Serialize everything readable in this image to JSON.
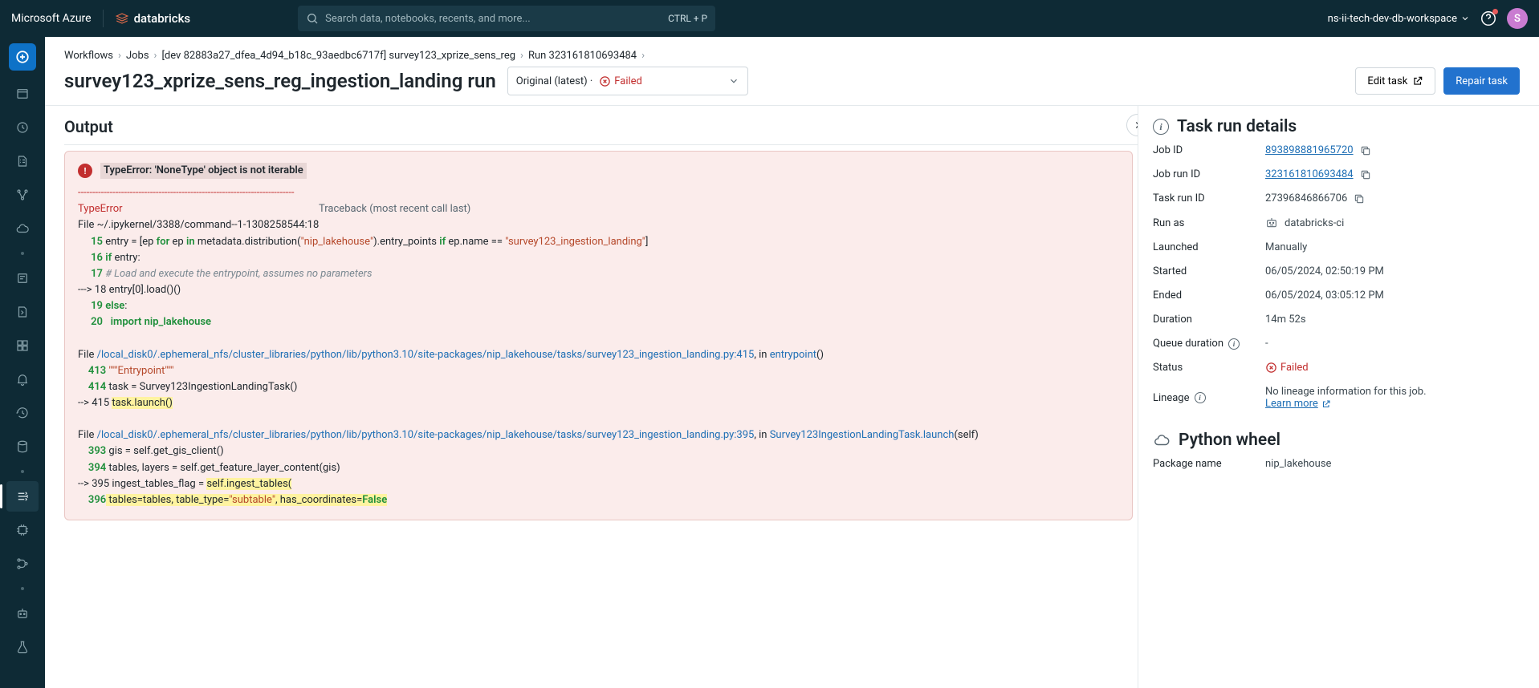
{
  "topbar": {
    "azure": "Microsoft Azure",
    "brand": "databricks",
    "search_placeholder": "Search data, notebooks, recents, and more...",
    "kbd": "CTRL + P",
    "workspace": "ns-ii-tech-dev-db-workspace",
    "avatar": "S"
  },
  "breadcrumb": {
    "items": [
      "Workflows",
      "Jobs",
      "[dev 82883a27_dfea_4d94_b18c_93aedbc6717f] survey123_xprize_sens_reg",
      "Run 323161810693484"
    ]
  },
  "page": {
    "title": "survey123_xprize_sens_reg_ingestion_landing run",
    "run_select_label": "Original (latest) ·",
    "run_status": "Failed",
    "edit": "Edit task",
    "repair": "Repair task"
  },
  "output": {
    "heading": "Output",
    "error_message": "TypeError: 'NoneType' object is not iterable",
    "dashes": "---------------------------------------------------------------------------",
    "tb_type": "TypeError",
    "tb_right": "Traceback (most recent call last)",
    "line_file1": "File ~/.ipykernel/3388/command--1-1308258544:18",
    "l15a": "15",
    "l15b": " entry = [ep ",
    "l15c": "for",
    "l15d": " ep ",
    "l15e": "in",
    "l15f": " metadata.distribution(",
    "l15g": "\"nip_lakehouse\"",
    "l15h": ").entry_points ",
    "l15i": "if",
    "l15j": " ep.name == ",
    "l15k": "\"survey123_ingestion_landing\"",
    "l15l": "]",
    "l16a": "16",
    "l16b": "if",
    "l16c": " entry:",
    "l17a": "17",
    "l17b": "   # Load and execute the entrypoint, assumes no parameters",
    "l18a": "---> 18   entry[0].load()()",
    "l19a": "19",
    "l19b": "else",
    "l19c": ":",
    "l20a": "20",
    "l20b": "import",
    "l20c": "nip_lakehouse",
    "file2a": "File ",
    "file2b": "/local_disk0/.ephemeral_nfs/cluster_libraries/python/lib/python3.10/site-packages/nip_lakehouse/tasks/survey123_ingestion_landing.py:415",
    "file2c": ", in ",
    "file2d": "entrypoint",
    "file2e": "()",
    "l413a": "413",
    "l413b": "\"\"\"Entrypoint\"\"\"",
    "l414a": "414",
    "l414b": " task = Survey123IngestionLandingTask()",
    "l415a": "--> 415 ",
    "l415b": "task.launch()",
    "file3a": "File ",
    "file3b": "/local_disk0/.ephemeral_nfs/cluster_libraries/python/lib/python3.10/site-packages/nip_lakehouse/tasks/survey123_ingestion_landing.py:395",
    "file3c": ", in ",
    "file3d": "Survey123IngestionLandingTask.launch",
    "file3e": "(self)",
    "l393a": "393",
    "l393b": " gis = self.get_gis_client()",
    "l394a": "394",
    "l394b": " tables, layers = self.get_feature_layer_content(gis)",
    "l395a": "--> 395 ingest_tables_flag = ",
    "l395b": "self.ingest_tables(",
    "l396a": "396",
    "l396b": "    tables=tables, table_type=",
    "l396c": "\"subtable\"",
    "l396d": ", has_coordinates=",
    "l396e": "False"
  },
  "details": {
    "heading": "Task run details",
    "job_id_k": "Job ID",
    "job_id_v": "893898881965720",
    "job_run_id_k": "Job run ID",
    "job_run_id_v": "323161810693484",
    "task_run_id_k": "Task run ID",
    "task_run_id_v": "27396846866706",
    "run_as_k": "Run as",
    "run_as_v": "databricks-ci",
    "launched_k": "Launched",
    "launched_v": "Manually",
    "started_k": "Started",
    "started_v": "06/05/2024, 02:50:19 PM",
    "ended_k": "Ended",
    "ended_v": "06/05/2024, 03:05:12 PM",
    "duration_k": "Duration",
    "duration_v": "14m 52s",
    "queue_k": "Queue duration",
    "queue_v": "-",
    "status_k": "Status",
    "status_v": "Failed",
    "lineage_k": "Lineage",
    "lineage_v": "No lineage information for this job.",
    "learn_more": "Learn more",
    "wheel_heading": "Python wheel",
    "pkg_k": "Package name",
    "pkg_v": "nip_lakehouse"
  }
}
